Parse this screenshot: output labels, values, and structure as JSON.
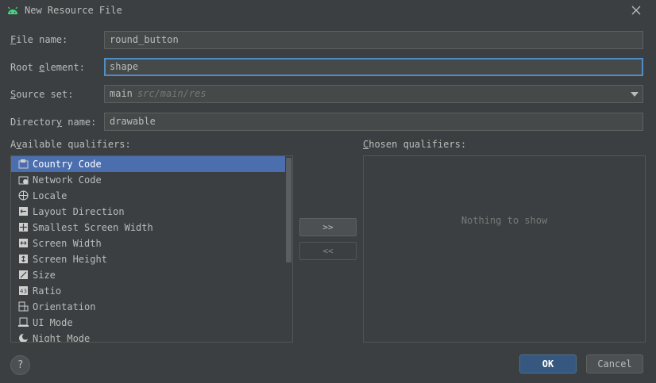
{
  "dialog": {
    "title": "New Resource File",
    "icon": "android-icon",
    "close_icon": "close-icon"
  },
  "form": {
    "file_name": {
      "label": "File name:",
      "value": "round_button"
    },
    "root_element": {
      "label": "Root element:",
      "value": "shape"
    },
    "source_set": {
      "label": "Source set:",
      "value": "main",
      "path": "src/main/res"
    },
    "directory_name": {
      "label": "Directory name:",
      "value": "drawable"
    }
  },
  "available": {
    "label": "Available qualifiers:",
    "items": [
      {
        "label": "Country Code",
        "icon": "country-code-icon",
        "selected": true
      },
      {
        "label": "Network Code",
        "icon": "network-code-icon"
      },
      {
        "label": "Locale",
        "icon": "globe-icon"
      },
      {
        "label": "Layout Direction",
        "icon": "layout-direction-icon"
      },
      {
        "label": "Smallest Screen Width",
        "icon": "smallest-width-icon"
      },
      {
        "label": "Screen Width",
        "icon": "screen-width-icon"
      },
      {
        "label": "Screen Height",
        "icon": "screen-height-icon"
      },
      {
        "label": "Size",
        "icon": "size-icon"
      },
      {
        "label": "Ratio",
        "icon": "ratio-icon",
        "glyph": "43"
      },
      {
        "label": "Orientation",
        "icon": "orientation-icon"
      },
      {
        "label": "UI Mode",
        "icon": "ui-mode-icon"
      },
      {
        "label": "Night Mode",
        "icon": "night-mode-icon"
      }
    ]
  },
  "move": {
    "add_label": ">>",
    "remove_label": "<<"
  },
  "chosen": {
    "label": "Chosen qualifiers:",
    "empty_text": "Nothing to show"
  },
  "footer": {
    "help_label": "?",
    "ok_label": "OK",
    "cancel_label": "Cancel"
  },
  "colors": {
    "background": "#3c3f41",
    "selection": "#4b6eaf",
    "focus": "#4f8ec5",
    "ok_button": "#365880"
  }
}
